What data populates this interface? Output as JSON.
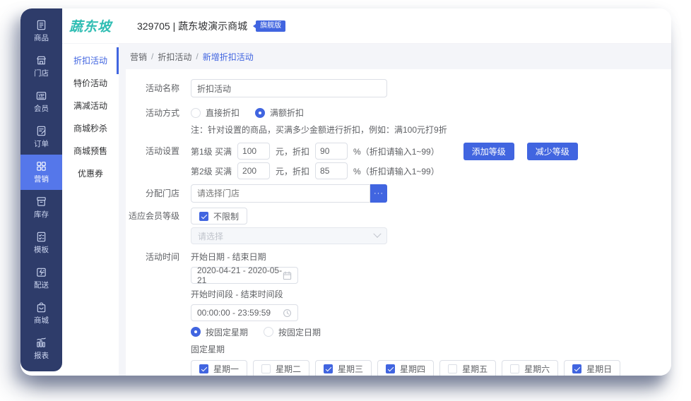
{
  "app": {
    "logo": "蔬东坡",
    "store_title": "329705 | 蔬东坡演示商城",
    "badge": "旗舰版"
  },
  "colors": {
    "primary": "#4165e0",
    "sidebar": "#2e3c6a",
    "sidebar_active": "#5577ea",
    "logo_teal": "#2fbdb3",
    "page_bg": "#f4f5f9"
  },
  "sidebar": {
    "items": [
      {
        "label": "商品",
        "icon": "goods-icon",
        "active": false
      },
      {
        "label": "门店",
        "icon": "shop-icon",
        "active": false
      },
      {
        "label": "会员",
        "icon": "vip-card-icon",
        "active": false
      },
      {
        "label": "订单",
        "icon": "order-icon",
        "active": false
      },
      {
        "label": "营销",
        "icon": "marketing-grid-icon",
        "active": true
      },
      {
        "label": "库存",
        "icon": "inventory-icon",
        "active": false
      },
      {
        "label": "模板",
        "icon": "template-icon",
        "active": false
      },
      {
        "label": "配送",
        "icon": "delivery-icon",
        "active": false
      },
      {
        "label": "商城",
        "icon": "mall-bag-icon",
        "active": false
      },
      {
        "label": "报表",
        "icon": "report-chart-icon",
        "active": false
      }
    ]
  },
  "submenu": {
    "items": [
      {
        "label": "折扣活动",
        "active": true
      },
      {
        "label": "特价活动",
        "active": false
      },
      {
        "label": "满减活动",
        "active": false
      },
      {
        "label": "商城秒杀",
        "active": false
      },
      {
        "label": "商城预售",
        "active": false
      },
      {
        "label": "优惠券",
        "active": false
      }
    ]
  },
  "breadcrumb": {
    "sep": "/",
    "items": [
      "营销",
      "折扣活动",
      "新增折扣活动"
    ]
  },
  "form": {
    "name": {
      "label": "活动名称",
      "value": "折扣活动"
    },
    "mode": {
      "label": "活动方式",
      "options": [
        {
          "label": "直接折扣",
          "selected": false
        },
        {
          "label": "满额折扣",
          "selected": true
        }
      ],
      "note": "注：针对设置的商品，买满多少金额进行折扣，例如：满100元打9折"
    },
    "levels": {
      "label": "活动设置",
      "rows": [
        {
          "prefix": "第1级 买满",
          "amount": "100",
          "mid": "元，折扣",
          "discount": "90",
          "suffix": "%（折扣请输入1~99）"
        },
        {
          "prefix": "第2级 买满",
          "amount": "200",
          "mid": "元，折扣",
          "discount": "85",
          "suffix": "%（折扣请输入1~99）"
        }
      ],
      "add_button": "添加等级",
      "remove_button": "减少等级"
    },
    "stores": {
      "label": "分配门店",
      "placeholder": "请选择门店",
      "more_button": "···"
    },
    "member": {
      "label": "适应会员等级",
      "unlimited_label": "不限制",
      "unlimited_checked": true,
      "select_placeholder": "请选择"
    },
    "time": {
      "label": "活动时间",
      "date_range_label": "开始日期 - 结束日期",
      "date_range_value": "2020-04-21 - 2020-05-21",
      "time_range_label": "开始时间段 - 结束时间段",
      "time_range_value": "00:00:00 - 23:59:59",
      "repeat_options": [
        {
          "label": "按固定星期",
          "selected": true
        },
        {
          "label": "按固定日期",
          "selected": false
        }
      ],
      "fixed_week_label": "固定星期",
      "weekdays": [
        {
          "label": "星期一",
          "checked": true
        },
        {
          "label": "星期二",
          "checked": false
        },
        {
          "label": "星期三",
          "checked": true
        },
        {
          "label": "星期四",
          "checked": true
        },
        {
          "label": "星期五",
          "checked": false
        },
        {
          "label": "星期六",
          "checked": false
        },
        {
          "label": "星期日",
          "checked": true
        }
      ]
    }
  }
}
